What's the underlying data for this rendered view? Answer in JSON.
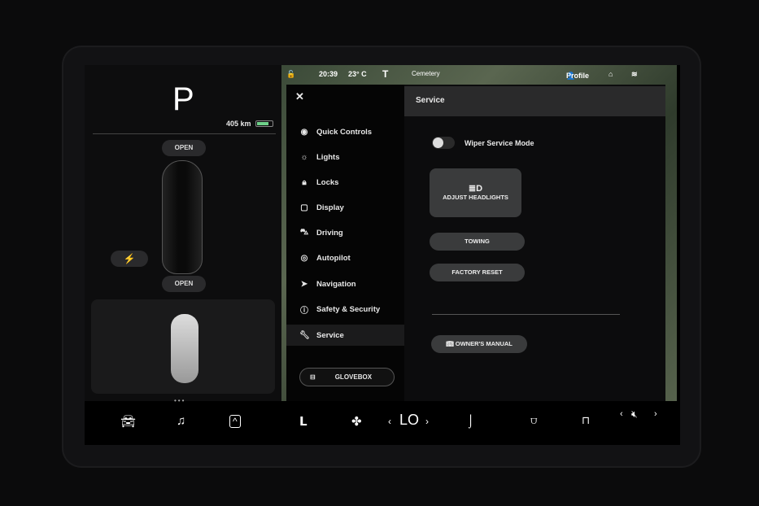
{
  "drive": {
    "gear": "P",
    "range": "405 km",
    "battery_fraction": 0.8,
    "frunk": "OPEN",
    "trunk": "OPEN",
    "charge_icon": "lightning-icon"
  },
  "status": {
    "time": "20:39",
    "temp": "23° C",
    "map_label": "Cemetery",
    "profile": "Profile"
  },
  "settings": {
    "close": "✕",
    "nav": [
      {
        "label": "Quick Controls",
        "icon": "toggle-icon"
      },
      {
        "label": "Lights",
        "icon": "sun-icon"
      },
      {
        "label": "Locks",
        "icon": "lock-icon"
      },
      {
        "label": "Display",
        "icon": "display-icon"
      },
      {
        "label": "Driving",
        "icon": "car-icon"
      },
      {
        "label": "Autopilot",
        "icon": "steering-wheel-icon"
      },
      {
        "label": "Navigation",
        "icon": "navigation-icon"
      },
      {
        "label": "Safety & Security",
        "icon": "alert-icon"
      },
      {
        "label": "Service",
        "icon": "wrench-icon"
      }
    ],
    "glovebox": "GLOVEBOX",
    "title": "Service",
    "wiper_label": "Wiper Service Mode",
    "wiper_on": false,
    "adjust_headlights": "ADJUST HEADLIGHTS",
    "towing": "TOWING",
    "factory_reset": "FACTORY RESET",
    "owners_manual": "OWNER'S MANUAL"
  },
  "bottom": {
    "temp": "LO",
    "prev": "‹",
    "next": "›"
  }
}
